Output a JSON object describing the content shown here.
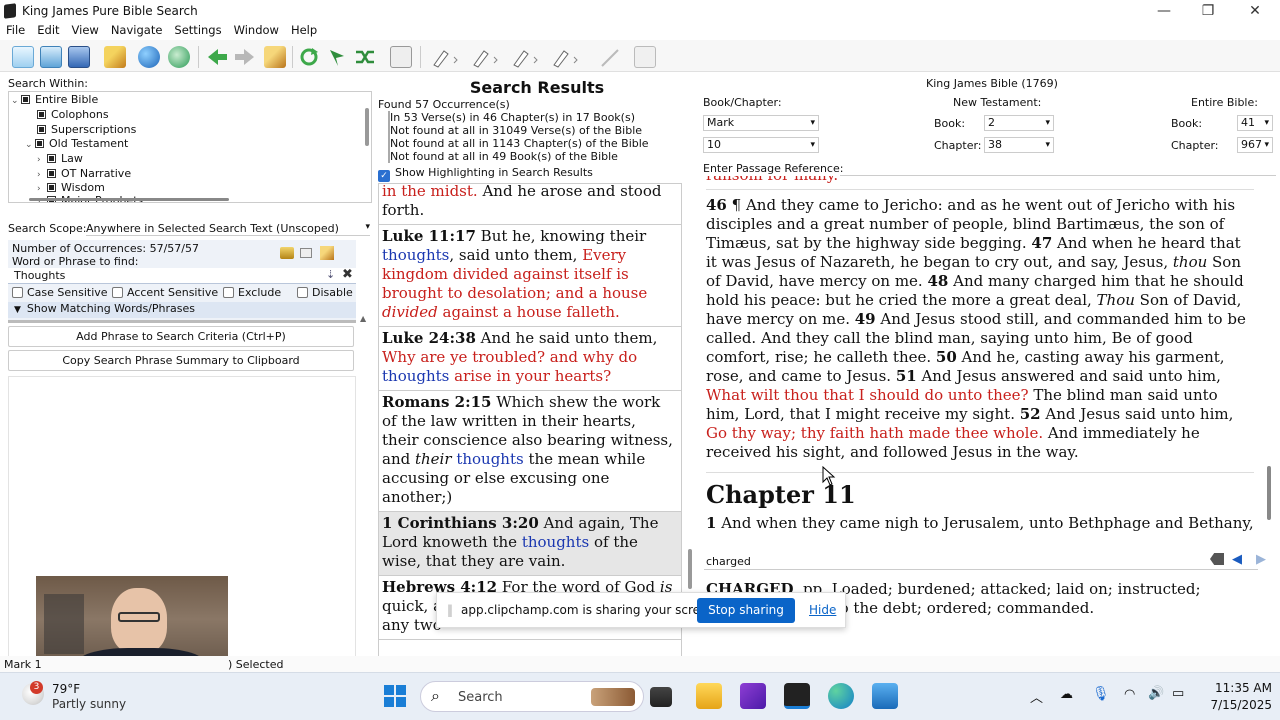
{
  "window": {
    "title": "King James Pure Bible Search",
    "min": "—",
    "restore": "❐",
    "close": "✕"
  },
  "menu": [
    "File",
    "Edit",
    "View",
    "Navigate",
    "Settings",
    "Window",
    "Help"
  ],
  "left": {
    "search_within_label": "Search Within:",
    "tree": [
      {
        "label": "Entire Bible",
        "arrow": "⌄",
        "level": 0
      },
      {
        "label": "Colophons",
        "arrow": "",
        "level": 1
      },
      {
        "label": "Superscriptions",
        "arrow": "",
        "level": 1
      },
      {
        "label": "Old Testament",
        "arrow": "⌄",
        "level": 1
      },
      {
        "label": "Law",
        "arrow": "›",
        "level": 2
      },
      {
        "label": "OT Narrative",
        "arrow": "›",
        "level": 2
      },
      {
        "label": "Wisdom",
        "arrow": "›",
        "level": 2
      },
      {
        "label": "Major Prophets",
        "arrow": "›",
        "level": 2
      }
    ],
    "scope_label": "Search Scope:",
    "scope_value": "Anywhere in Selected Search Text (Unscoped)",
    "occurrences": "Number of Occurrences: 57/57/57",
    "phrase_label": "Word or Phrase to find:",
    "phrase_value": "Thoughts",
    "options": [
      "Case Sensitive",
      "Accent Sensitive",
      "Exclude",
      "Disable"
    ],
    "show_matching": "Show Matching Words/Phrases",
    "add_phrase": "Add Phrase to Search Criteria (Ctrl+P)",
    "copy_summary": "Copy Search Phrase Summary to Clipboard"
  },
  "middle": {
    "header": "Search Results",
    "stats": [
      "Found 57 Occurrence(s)",
      "In 53 Verse(s) in 46 Chapter(s) in 17 Book(s)",
      "Not found at all in 31049 Verse(s) of the Bible",
      "Not found at all in 1143 Chapter(s) of the Bible",
      "Not found at all in 49 Book(s) of the Bible"
    ],
    "highlight_label": "Show Highlighting in Search Results",
    "results": [
      {
        "ref": "",
        "parts": [
          {
            "t": "in the midst.",
            "c": "red"
          },
          {
            "t": " And he arose and stood forth.",
            "c": ""
          }
        ]
      },
      {
        "ref": "Luke 11:17",
        "parts": [
          {
            "t": " But he, knowing their ",
            "c": ""
          },
          {
            "t": "thoughts",
            "c": "blue"
          },
          {
            "t": ", said unto them, ",
            "c": ""
          },
          {
            "t": "Every kingdom divided against itself is brought to desolation; and a house ",
            "c": "red"
          },
          {
            "t": "divided",
            "c": "red-i"
          },
          {
            "t": " against a house falleth.",
            "c": "red"
          }
        ]
      },
      {
        "ref": "Luke 24:38",
        "parts": [
          {
            "t": " And he said unto them, ",
            "c": ""
          },
          {
            "t": "Why are ye troubled? and why do ",
            "c": "red"
          },
          {
            "t": "thoughts",
            "c": "blue"
          },
          {
            "t": " arise in your hearts?",
            "c": "red"
          }
        ]
      },
      {
        "ref": "Romans 2:15",
        "parts": [
          {
            "t": " Which shew the work of the law written in their hearts, their conscience also bearing witness, and ",
            "c": ""
          },
          {
            "t": "their",
            "c": "i"
          },
          {
            "t": " ",
            "c": ""
          },
          {
            "t": "thoughts",
            "c": "blue"
          },
          {
            "t": " the mean while accusing or else excusing one another;)",
            "c": ""
          }
        ]
      },
      {
        "ref": "1 Corinthians 3:20",
        "parts": [
          {
            "t": " And again, The Lord knoweth the ",
            "c": ""
          },
          {
            "t": "thoughts",
            "c": "blue"
          },
          {
            "t": " of the wise, that they are vain.",
            "c": ""
          }
        ]
      },
      {
        "ref": "Hebrews 4:12",
        "parts": [
          {
            "t": " For the word of God ",
            "c": ""
          },
          {
            "t": "is",
            "c": "i"
          },
          {
            "t": " quick, and powerful, and sharper than any two",
            "c": ""
          }
        ]
      }
    ]
  },
  "right": {
    "bible_title": "King James Bible (1769)",
    "book_chapter_label": "Book/Chapter:",
    "nt_label": "New Testament:",
    "entire_label": "Entire Bible:",
    "book_value": "Mark",
    "chapter_value": "10",
    "book_label": "Book:",
    "chapter_label": "Chapter:",
    "nt_book": "2",
    "nt_chapter": "38",
    "eb_book": "41",
    "eb_chapter": "967",
    "passage_ref_label": "Enter Passage Reference:",
    "passage_top": "ransom for many.",
    "passage": [
      {
        "t": "46",
        "c": "b"
      },
      {
        "t": " ¶ And they came to Jericho: and as he went out of Jericho with his disciples and a great number of people, blind Bartimæus, the son of Timæus, sat by the highway side begging. ",
        "c": ""
      },
      {
        "t": "47",
        "c": "b"
      },
      {
        "t": " And when he heard that it was Jesus of Nazareth, he began to cry out, and say, Jesus, ",
        "c": ""
      },
      {
        "t": "thou",
        "c": "i"
      },
      {
        "t": " Son of David, have mercy on me. ",
        "c": ""
      },
      {
        "t": "48",
        "c": "b"
      },
      {
        "t": " And many charged him that he should hold his peace: but he cried the more a great deal, ",
        "c": ""
      },
      {
        "t": "Thou",
        "c": "i"
      },
      {
        "t": " Son of David, have mercy on me. ",
        "c": ""
      },
      {
        "t": "49",
        "c": "b"
      },
      {
        "t": " And Jesus stood still, and commanded him to be called. And they call the blind man, saying unto him, Be of good comfort, rise; he calleth thee. ",
        "c": ""
      },
      {
        "t": "50",
        "c": "b"
      },
      {
        "t": " And he, casting away his garment, rose, and came to Jesus. ",
        "c": ""
      },
      {
        "t": "51",
        "c": "b"
      },
      {
        "t": " And Jesus answered and said unto him, ",
        "c": ""
      },
      {
        "t": "What wilt thou that I should do unto thee?",
        "c": "red"
      },
      {
        "t": " The blind man said unto him, Lord, that I might receive my sight. ",
        "c": ""
      },
      {
        "t": "52",
        "c": "b"
      },
      {
        "t": " And Jesus said unto him, ",
        "c": ""
      },
      {
        "t": "Go thy way; thy faith hath made thee whole.",
        "c": "red"
      },
      {
        "t": " And immediately he received his sight, and followed Jesus in the way.",
        "c": ""
      }
    ],
    "chapter_heading": "Chapter 11",
    "next_verse_num": "1",
    "next_verse": " And when they came nigh to Jerusalem, unto Bethphage and Bethany,",
    "dict_search": "charged",
    "dict_head": "CHARGED",
    "dict_text": ", pp. Loaded; burdened; attacked; laid on; instructed; imputed; placed to the debt; ordered; commanded."
  },
  "status": {
    "left": "Mark 1",
    "right": ") Selected"
  },
  "share": {
    "text": "app.clipchamp.com is sharing your screen.",
    "stop": "Stop sharing",
    "hide": "Hide"
  },
  "taskbar": {
    "weather_temp": "79°F",
    "weather_desc": "Partly sunny",
    "badge": "3",
    "search": "Search",
    "time": "11:35 AM",
    "date": "7/15/2025"
  },
  "colors": {
    "red_letter": "#c8201c",
    "highlight_blue": "#1a37b0",
    "accent": "#0a64c8"
  }
}
